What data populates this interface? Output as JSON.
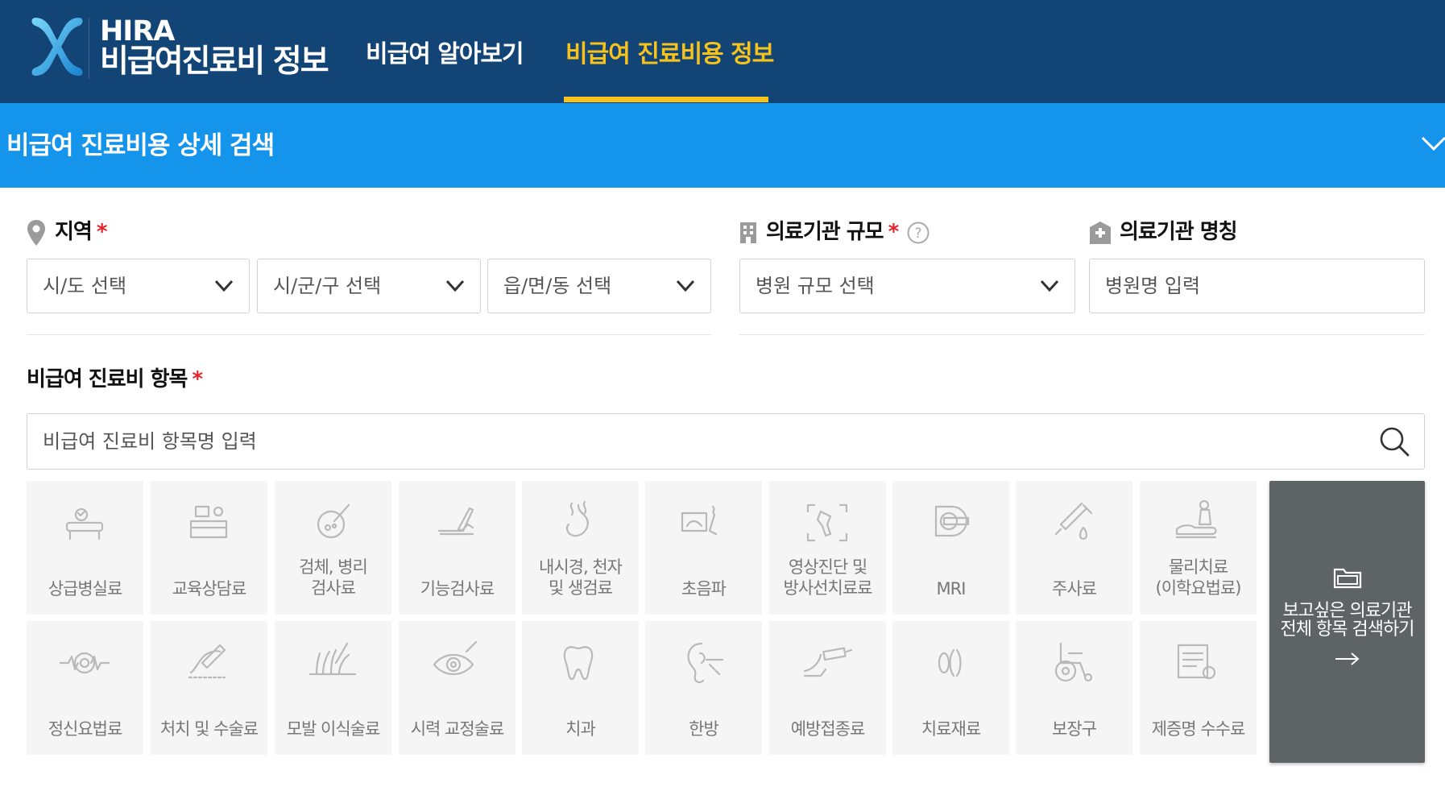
{
  "brand": {
    "name": "HIRA",
    "subtitle": "비급여진료비 정보"
  },
  "nav": {
    "items": [
      {
        "label": "비급여 알아보기"
      },
      {
        "label": "비급여 진료비용 정보"
      }
    ],
    "active_index": 1
  },
  "search_panel": {
    "title": "비급여 진료비용 상세 검색"
  },
  "region": {
    "label": "지역",
    "required_mark": "*",
    "selects": [
      {
        "placeholder": "시/도 선택"
      },
      {
        "placeholder": "시/군/구 선택"
      },
      {
        "placeholder": "읍/면/동 선택"
      }
    ]
  },
  "facility_scale": {
    "label": "의료기관 규모",
    "required_mark": "*",
    "placeholder": "병원 규모 선택"
  },
  "facility_name": {
    "label": "의료기관 명칭",
    "placeholder": "병원명 입력"
  },
  "items_section": {
    "label": "비급여 진료비 항목",
    "required_mark": "*",
    "search_placeholder": "비급여 진료비 항목명 입력"
  },
  "categories": [
    {
      "label": "상급병실료",
      "icon": "hospital-bed-icon"
    },
    {
      "label": "교육상담료",
      "icon": "counseling-desk-icon"
    },
    {
      "label": "검체, 병리 검사료",
      "icon": "lab-test-icon"
    },
    {
      "label": "기능검사료",
      "icon": "function-test-icon"
    },
    {
      "label": "내시경, 천자 및 생검료",
      "icon": "stomach-endoscope-icon"
    },
    {
      "label": "초음파",
      "icon": "ultrasound-icon"
    },
    {
      "label": "영상진단 및 방사선치료료",
      "icon": "xray-scan-icon"
    },
    {
      "label": "MRI",
      "icon": "mri-machine-icon"
    },
    {
      "label": "주사료",
      "icon": "syringe-icon"
    },
    {
      "label": "물리치료 (이학요법료)",
      "icon": "physical-therapy-icon"
    },
    {
      "label": "정신요법료",
      "icon": "brain-wave-icon"
    },
    {
      "label": "처치 및 수술료",
      "icon": "surgery-hand-icon"
    },
    {
      "label": "모발 이식술료",
      "icon": "hair-transplant-icon"
    },
    {
      "label": "시력 교정술료",
      "icon": "eye-laser-icon"
    },
    {
      "label": "치과",
      "icon": "tooth-icon"
    },
    {
      "label": "한방",
      "icon": "ear-acupuncture-icon"
    },
    {
      "label": "예방접종료",
      "icon": "vaccination-icon"
    },
    {
      "label": "치료재료",
      "icon": "lens-material-icon"
    },
    {
      "label": "보장구",
      "icon": "wheelchair-icon"
    },
    {
      "label": "제증명 수수료",
      "icon": "certificate-icon"
    }
  ],
  "full_search_button": {
    "line1": "보고싶은 의료기관",
    "line2": "전체 항목 검색하기",
    "icon": "folder-icon",
    "arrow_icon": "arrow-right-icon"
  },
  "colors": {
    "header_bg": "#124476",
    "accent_yellow": "#f6c21b",
    "panel_blue": "#1594ec",
    "required_red": "#e4232b",
    "tile_bg": "#f5f5f5",
    "button_dark": "#5e6366"
  }
}
